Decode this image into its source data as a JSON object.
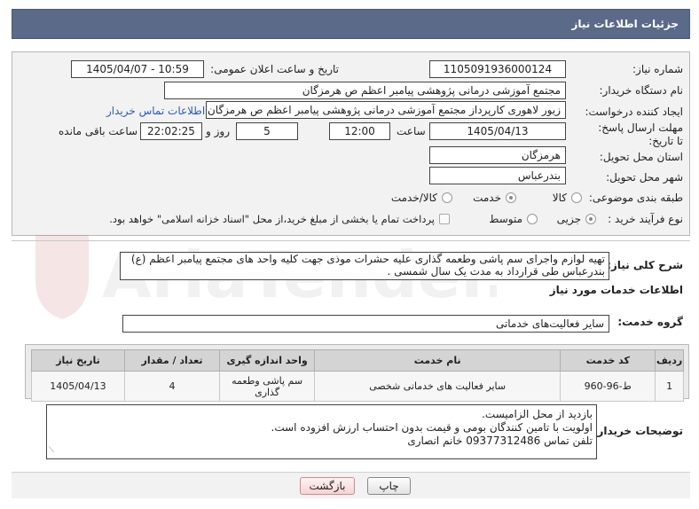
{
  "header": {
    "title": "جزئیات اطلاعات نیاز"
  },
  "need_number": {
    "label": "شماره نیاز:",
    "value": "1105091936000124"
  },
  "announce_datetime": {
    "label": "تاریخ و ساعت اعلان عمومی:",
    "value": "1405/04/07 - 10:59"
  },
  "buyer_org": {
    "label": "نام دستگاه خریدار:",
    "value": "مجتمع آموزشی درمانی پژوهشی پیامبر اعظم ص  هرمزگان"
  },
  "requester": {
    "label": "ایجاد کننده درخواست:",
    "value": "زیور لاهوری کارپرداز مجتمع آموزشی درمانی پژوهشی پیامبر اعظم ص  هرمزگان",
    "contact_link": "اطلاعات تماس خریدار"
  },
  "deadline": {
    "label": "مهلت ارسال پاسخ: تا تاریخ:",
    "date": "1405/04/13",
    "time_label": "ساعت",
    "time": "12:00",
    "days": "5",
    "days_label": "روز و",
    "remaining": "22:02:25",
    "remaining_label": "ساعت باقی مانده"
  },
  "province": {
    "label": "استان محل تحویل:",
    "value": "هرمزگان"
  },
  "city": {
    "label": "شهر محل تحویل:",
    "value": "بندرعباس"
  },
  "category": {
    "label": "طبقه بندی موضوعی:",
    "options": [
      "کالا",
      "خدمت",
      "کالا/خدمت"
    ],
    "selected": "خدمت"
  },
  "purchase_type": {
    "label": "نوع فرآیند خرید :",
    "options": [
      "جزیی",
      "متوسط"
    ],
    "selected": "جزیی",
    "note": "پرداخت تمام یا بخشی از مبلغ خرید،از محل \"اسناد خزانه اسلامی\" خواهد بود."
  },
  "description": {
    "label": "شرح کلی نیاز:",
    "line1": "تهیه لوازم واجرای سم پاشی وطعمه گذاری علیه حشرات موذی جهت کلیه واحد های مجتمع پیامبر اعظم (ع)",
    "line2": "بندرعباس طی قرارداد به مدت یک سال شمسی ."
  },
  "services_info": {
    "title": "اطلاعات خدمات مورد نیاز"
  },
  "service_group": {
    "label": "گروه خدمت:",
    "value": "سایر فعالیت‌های خدماتی"
  },
  "table": {
    "headers": [
      "ردیف",
      "کد خدمت",
      "نام خدمت",
      "واحد اندازه گیری",
      "تعداد / مقدار",
      "تاریخ نیاز"
    ],
    "rows": [
      {
        "row": "1",
        "code": "ط-96-960",
        "name": "سایر فعالیت های خدماتی شخصی",
        "unit": "سم پاشی وطعمه گذاری",
        "qty": "4",
        "date": "1405/04/13"
      }
    ]
  },
  "buyer_notes": {
    "label": "توضیحات خریدار:",
    "line1": "بازدید از محل الزامیست.",
    "line2": "اولویت با تامین کنندگان بومی و قیمت بدون احتساب ارزش افزوده است.",
    "line3": "تلفن تماس  09377312486 خانم انصاری"
  },
  "buttons": {
    "print": "چاپ",
    "back": "بازگشت"
  },
  "watermark": {
    "text": "AriaTender.net"
  },
  "colors": {
    "header_bg": "#5a6a88",
    "link": "#2a5db0",
    "back_button": "#f6d4d4"
  }
}
